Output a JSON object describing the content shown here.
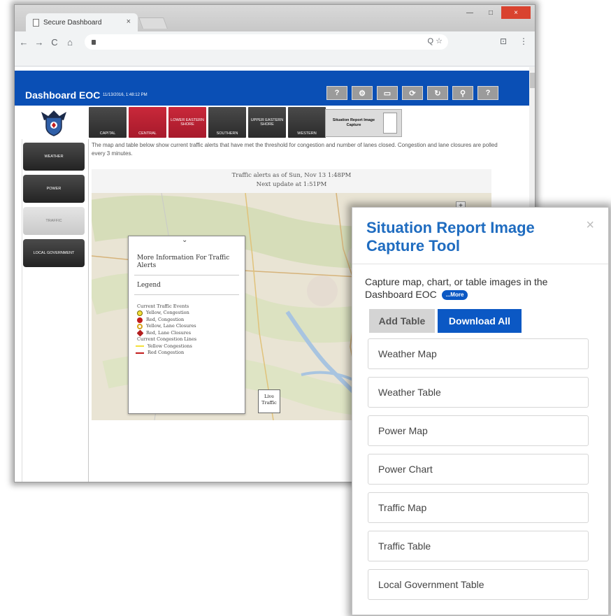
{
  "browser": {
    "tab_title": "Secure Dashboard",
    "tab_close": "×",
    "window_controls": {
      "minimize": "—",
      "maximize": "□",
      "close": "×"
    },
    "nav": {
      "back": "←",
      "forward": "→",
      "reload": "C",
      "home": "⌂"
    },
    "omnibox_icons": "Q ☆",
    "menu_icons": [
      "⊡",
      "⋮"
    ]
  },
  "header": {
    "title": "Dashboard EOC",
    "date": "11/13/2016, 1:48:12 PM",
    "tools": [
      "?",
      "⚙",
      "▭",
      "⟳",
      "↻",
      "⚲",
      "?"
    ]
  },
  "regions": [
    {
      "label": "CAPITAL",
      "style": "dark"
    },
    {
      "label": "CENTRAL",
      "style": "red"
    },
    {
      "label": "LOWER EASTERN SHORE",
      "style": "red"
    },
    {
      "label": "SOUTHERN",
      "style": "dark"
    },
    {
      "label": "UPPER EASTERN SHORE",
      "style": "dark"
    },
    {
      "label": "WESTERN",
      "style": "dark"
    }
  ],
  "sitrep_button": "Situation Report Image Capture",
  "sidebar": {
    "items": [
      {
        "label": "WEATHER"
      },
      {
        "label": "POWER"
      },
      {
        "label": "TRAFFIC"
      },
      {
        "label": "LOCAL GOVERNMENT"
      }
    ]
  },
  "main": {
    "description": "The map and table below show current traffic alerts that have met the threshold for congestion and number of lanes closed. Congestion and lane closures are polled every 3 minutes.",
    "alerts_as_of": "Traffic alerts as of Sun, Nov 13 1:48PM",
    "next_update": "Next update at 1:51PM"
  },
  "info_panel": {
    "chevron": "⌄",
    "title": "More Information For Traffic Alerts",
    "legend_heading": "Legend",
    "current_events": "Current Traffic Events",
    "items": [
      {
        "label": "Yellow, Congestion"
      },
      {
        "label": "Red, Congestion"
      },
      {
        "label": "Yellow, Lane Closures"
      },
      {
        "label": "Red, Lane Closures"
      }
    ],
    "current_lines": "Current Congestion Lines",
    "line_items": [
      {
        "label": "Yellow Congestions"
      },
      {
        "label": "Red Congestion"
      }
    ]
  },
  "live_traffic": "Live Traffic",
  "map_zoom_plus": "+",
  "popup": {
    "title": "Situation Report Image Capture Tool",
    "close": "×",
    "description": "Capture map, chart, or table images in the Dashboard EOC",
    "more": "...More",
    "add_table": "Add Table",
    "download_all": "Download All",
    "items": [
      "Weather Map",
      "Weather Table",
      "Power Map",
      "Power Chart",
      "Traffic Map",
      "Traffic Table",
      "Local Government Table"
    ]
  }
}
